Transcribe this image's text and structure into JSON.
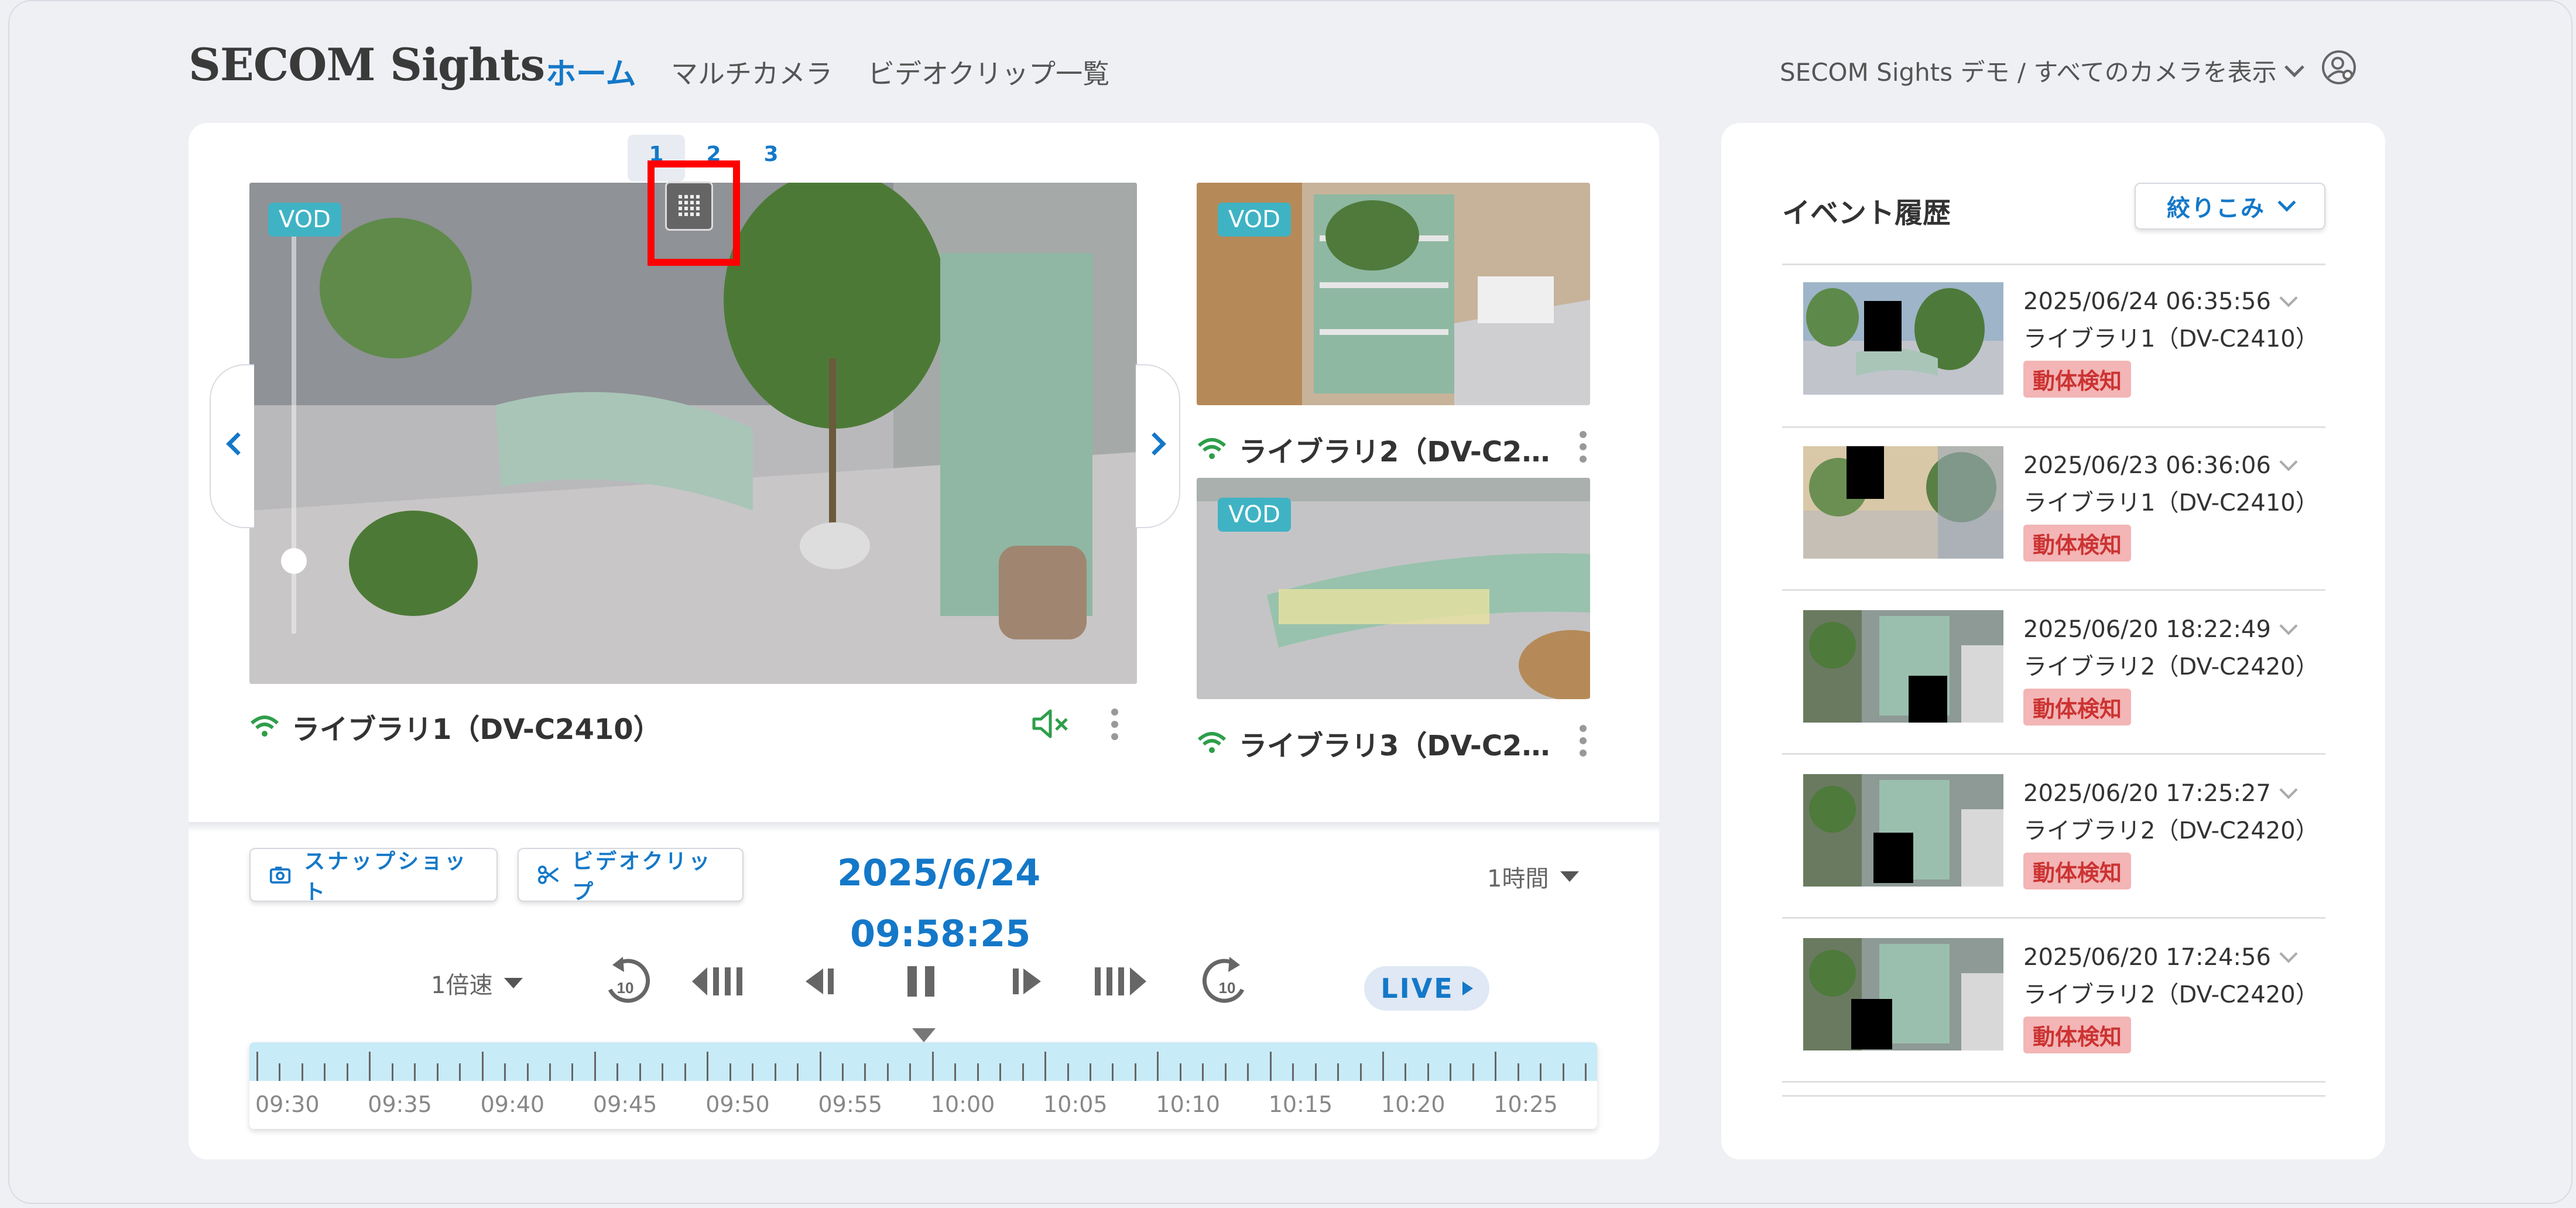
{
  "app": {
    "logo": "SECOM Sights"
  },
  "nav": {
    "home": "ホーム",
    "multi_camera": "マルチカメラ",
    "clip_list": "ビデオクリップ一覧"
  },
  "context": {
    "label": "SECOM Sights デモ / すべてのカメラを表示"
  },
  "pages": [
    "1",
    "2",
    "3"
  ],
  "main_camera": {
    "badge": "VOD",
    "name": "ライブラリ1（DV-C2410）"
  },
  "side_cameras": [
    {
      "badge": "VOD",
      "name": "ライブラリ2（DV-C2…"
    },
    {
      "badge": "VOD",
      "name": "ライブラリ3（DV-C2…"
    }
  ],
  "controls": {
    "snapshot": "スナップショット",
    "clip": "ビデオクリップ",
    "date": "2025/6/24",
    "time": "09:58:25",
    "range": "1時間",
    "speed": "1倍速",
    "skip_back": "10",
    "skip_forward": "10",
    "live": "LIVE"
  },
  "timeline": {
    "labels": [
      "09:30",
      "09:35",
      "09:40",
      "09:45",
      "09:50",
      "09:55",
      "10:00",
      "10:05",
      "10:10",
      "10:15",
      "10:20",
      "10:25"
    ]
  },
  "events": {
    "title": "イベント履歴",
    "filter": "絞りこみ",
    "items": [
      {
        "datetime": "2025/06/24  06:35:56",
        "camera": "ライブラリ1（DV-C2410）",
        "tag": "動体検知"
      },
      {
        "datetime": "2025/06/23  06:36:06",
        "camera": "ライブラリ1（DV-C2410）",
        "tag": "動体検知"
      },
      {
        "datetime": "2025/06/20  18:22:49",
        "camera": "ライブラリ2（DV-C2420）",
        "tag": "動体検知"
      },
      {
        "datetime": "2025/06/20  17:25:27",
        "camera": "ライブラリ2（DV-C2420）",
        "tag": "動体検知"
      },
      {
        "datetime": "2025/06/20  17:24:56",
        "camera": "ライブラリ2（DV-C2420）",
        "tag": "動体検知"
      }
    ]
  },
  "colors": {
    "accent": "#1478c8",
    "badge": "#3fb3c4",
    "wifi": "#2e9e4a",
    "tag_bg": "#f3b5b5",
    "highlight": "#ff0000"
  }
}
